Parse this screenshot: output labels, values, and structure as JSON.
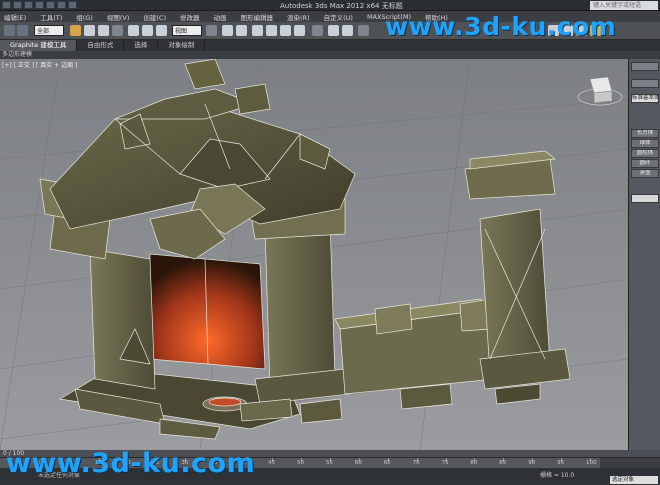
{
  "window": {
    "title": "Autodesk 3ds Max 2012 x64   无标题",
    "search_placeholder": "键入关键字或短语"
  },
  "menubar": {
    "items": [
      "编辑(E)",
      "工具(T)",
      "组(G)",
      "视图(V)",
      "创建(C)",
      "修改器",
      "动画",
      "图形编辑器",
      "渲染(R)",
      "自定义(U)",
      "MAXScript(M)",
      "帮助(H)"
    ]
  },
  "toolbar": {
    "selection_filter": "全部",
    "reference_coord": "视图"
  },
  "ribbon": {
    "tabs": [
      "Graphite 建模工具",
      "自由形式",
      "选择",
      "对象绘制"
    ],
    "active_tab": "Graphite 建模工具",
    "sub_label": "多边形建模"
  },
  "viewport": {
    "label": "[+] [ 正交 ] [ 真实 + 边面 ]"
  },
  "command_panel": {
    "dropdown": "标准基本体",
    "buttons": [
      "长方体",
      "球体",
      "圆柱体",
      "圆环",
      "茶壶"
    ]
  },
  "timeline": {
    "frame_counter": "0 / 100",
    "ticks": [
      "0",
      "5",
      "10",
      "15",
      "20",
      "25",
      "30",
      "35",
      "40",
      "45",
      "50",
      "55",
      "60",
      "65",
      "70",
      "75",
      "80",
      "85",
      "90",
      "95",
      "100"
    ]
  },
  "statusbar": {
    "status": "未选定任何对象",
    "prompt": "",
    "grid": "栅格 = 10.0",
    "autokey": "自动关键点",
    "set_key": "选定对象"
  },
  "watermarks": {
    "top": "www.3d-ku.com",
    "bottom": "www.3d-ku.com"
  },
  "colors": {
    "accent": "#1ea4ff",
    "viewport_bg": "#8a8d90",
    "stone": "#5a5a40",
    "glow": "#c0451c"
  }
}
